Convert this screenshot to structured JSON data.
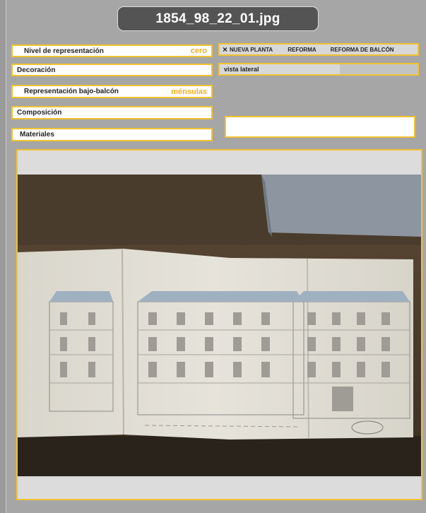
{
  "header": {
    "filename": "1854_98_22_01.jpg"
  },
  "fields": {
    "nivel": {
      "label": "Nivel de representación",
      "value": "cero"
    },
    "decoracion": {
      "label": "Decoración"
    },
    "bajo_balcon": {
      "label": "Representación bajo-balcón",
      "value": "ménsulas"
    },
    "composicion": {
      "label": "Composición"
    },
    "materiales": {
      "label": "Materiales"
    }
  },
  "options": {
    "close_icon": "×",
    "items": [
      "NUEVA PLANTA",
      "REFORMA",
      "REFORMA DE BALCÓN"
    ]
  },
  "view": {
    "label": "vista lateral"
  },
  "colors": {
    "accent": "#f2c230",
    "value_text": "#f2b01e",
    "title_bg": "#545454",
    "page_bg": "#a6a6a6"
  }
}
